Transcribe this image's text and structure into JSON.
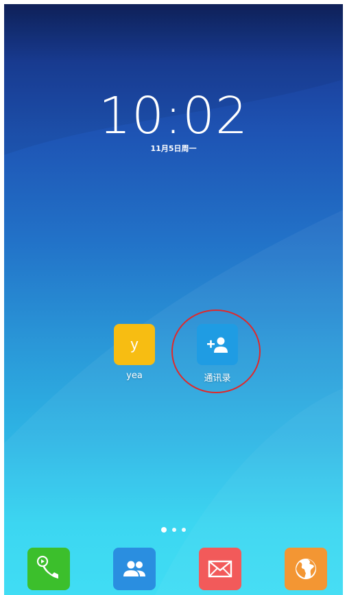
{
  "lockscreen": {
    "time": "10:02",
    "date": "11月5日周一"
  },
  "apps": [
    {
      "label": "yea",
      "glyph": "y",
      "color": "#f7bd12",
      "icon": "letter-y-icon"
    },
    {
      "label": "通讯录",
      "color": "#1f9ce3",
      "icon": "add-contact-icon"
    }
  ],
  "pager": {
    "page_count": 3,
    "current_page": 1
  },
  "dock": [
    {
      "icon": "phone-icon",
      "color": "#3cbf2c"
    },
    {
      "icon": "people-icon",
      "color": "#2a8ee0"
    },
    {
      "icon": "mail-icon",
      "color": "#f25a5a"
    },
    {
      "icon": "globe-icon",
      "color": "#f39633"
    }
  ],
  "highlight_color": "#e0282a"
}
